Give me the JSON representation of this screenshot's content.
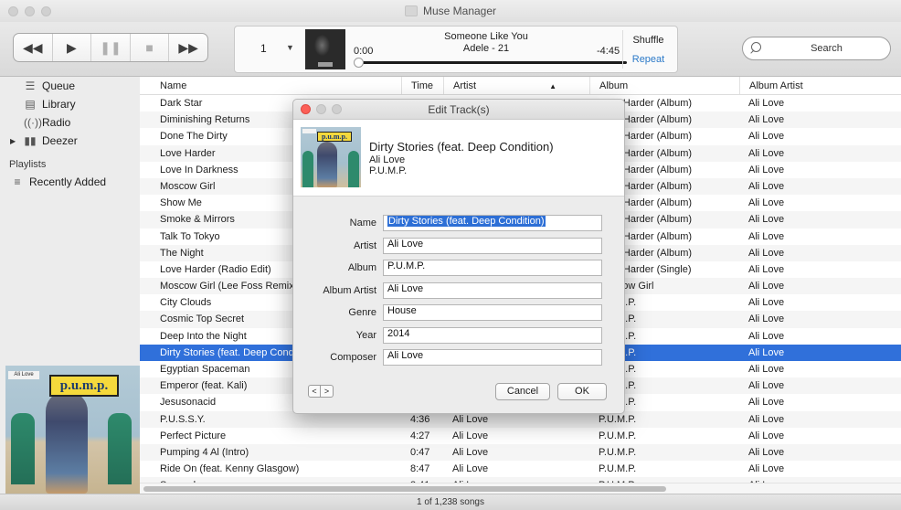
{
  "window": {
    "title": "Muse Manager"
  },
  "controls": {
    "rewind_icon": "rewind-icon",
    "play_icon": "play-icon",
    "pause_icon": "pause-icon",
    "stop_icon": "stop-icon",
    "forward_icon": "fast-forward-icon"
  },
  "player": {
    "queue_number": "1",
    "song_title": "Someone Like You",
    "song_subtitle": "Adele - 21",
    "elapsed": "0:00",
    "remaining": "-4:45",
    "progress": 0,
    "shuffle_label": "Shuffle",
    "repeat_label": "Repeat"
  },
  "search": {
    "placeholder": "Search"
  },
  "sidebar": {
    "items": [
      {
        "label": "Queue",
        "icon": "queue-icon"
      },
      {
        "label": "Library",
        "icon": "library-icon"
      },
      {
        "label": "Radio",
        "icon": "radio-icon"
      },
      {
        "label": "Deezer",
        "icon": "deezer-icon"
      }
    ],
    "playlists_header": "Playlists",
    "playlists": [
      {
        "label": "Recently Added",
        "icon": "playlist-icon"
      }
    ],
    "album_art": {
      "label": "Ali Love",
      "title": "p.u.m.p."
    }
  },
  "table": {
    "columns": [
      "Name",
      "Time",
      "Artist",
      "Album",
      "Album Artist"
    ],
    "sort_indicator": "▲",
    "rows": [
      {
        "name": "Dark Star",
        "time": "",
        "artist": "",
        "album": "Love Harder (Album)",
        "album_artist": "Ali Love"
      },
      {
        "name": "Diminishing Returns",
        "time": "",
        "artist": "",
        "album": "Love Harder (Album)",
        "album_artist": "Ali Love"
      },
      {
        "name": "Done The Dirty",
        "time": "",
        "artist": "",
        "album": "Love Harder (Album)",
        "album_artist": "Ali Love"
      },
      {
        "name": "Love Harder",
        "time": "",
        "artist": "",
        "album": "Love Harder (Album)",
        "album_artist": "Ali Love"
      },
      {
        "name": "Love In Darkness",
        "time": "",
        "artist": "",
        "album": "Love Harder (Album)",
        "album_artist": "Ali Love"
      },
      {
        "name": "Moscow Girl",
        "time": "",
        "artist": "",
        "album": "Love Harder (Album)",
        "album_artist": "Ali Love"
      },
      {
        "name": "Show Me",
        "time": "",
        "artist": "",
        "album": "Love Harder (Album)",
        "album_artist": "Ali Love"
      },
      {
        "name": "Smoke & Mirrors",
        "time": "",
        "artist": "",
        "album": "Love Harder (Album)",
        "album_artist": "Ali Love"
      },
      {
        "name": "Talk To Tokyo",
        "time": "",
        "artist": "",
        "album": "Love Harder (Album)",
        "album_artist": "Ali Love"
      },
      {
        "name": "The Night",
        "time": "",
        "artist": "",
        "album": "Love Harder (Album)",
        "album_artist": "Ali Love"
      },
      {
        "name": "Love Harder (Radio Edit)",
        "time": "",
        "artist": "",
        "album": "Love Harder (Single)",
        "album_artist": "Ali Love"
      },
      {
        "name": "Moscow Girl (Lee Foss Remix)",
        "time": "",
        "artist": "",
        "album": "Moscow Girl",
        "album_artist": "Ali Love"
      },
      {
        "name": "City Clouds",
        "time": "",
        "artist": "",
        "album": "P.U.M.P.",
        "album_artist": "Ali Love"
      },
      {
        "name": "Cosmic Top Secret",
        "time": "",
        "artist": "",
        "album": "P.U.M.P.",
        "album_artist": "Ali Love"
      },
      {
        "name": "Deep Into the Night",
        "time": "",
        "artist": "",
        "album": "P.U.M.P.",
        "album_artist": "Ali Love"
      },
      {
        "name": "Dirty Stories (feat. Deep Condition)",
        "time": "",
        "artist": "",
        "album": "P.U.M.P.",
        "album_artist": "Ali Love",
        "selected": true
      },
      {
        "name": "Egyptian Spaceman",
        "time": "",
        "artist": "",
        "album": "P.U.M.P.",
        "album_artist": "Ali Love"
      },
      {
        "name": "Emperor (feat. Kali)",
        "time": "",
        "artist": "",
        "album": "P.U.M.P.",
        "album_artist": "Ali Love"
      },
      {
        "name": "Jesusonacid",
        "time": "",
        "artist": "",
        "album": "P.U.M.P.",
        "album_artist": "Ali Love"
      },
      {
        "name": "P.U.S.S.Y.",
        "time": "4:36",
        "artist": "Ali Love",
        "album": "P.U.M.P.",
        "album_artist": "Ali Love"
      },
      {
        "name": "Perfect Picture",
        "time": "4:27",
        "artist": "Ali Love",
        "album": "P.U.M.P.",
        "album_artist": "Ali Love"
      },
      {
        "name": "Pumping 4 Al (Intro)",
        "time": "0:47",
        "artist": "Ali Love",
        "album": "P.U.M.P.",
        "album_artist": "Ali Love"
      },
      {
        "name": "Ride On (feat. Kenny Glasgow)",
        "time": "8:47",
        "artist": "Ali Love",
        "album": "P.U.M.P.",
        "album_artist": "Ali Love"
      },
      {
        "name": "Surrender",
        "time": "3:41",
        "artist": "Ali Love",
        "album": "P.U.M.P.",
        "album_artist": "Ali Love"
      }
    ]
  },
  "status": {
    "text": "1 of 1,238 songs"
  },
  "dialog": {
    "title": "Edit Track(s)",
    "track_title": "Dirty Stories (feat. Deep Condition)",
    "track_artist": "Ali Love",
    "track_album": "P.U.M.P.",
    "art_title": "p.u.m.p.",
    "fields": [
      {
        "label": "Name",
        "value": "Dirty Stories (feat. Deep Condition)"
      },
      {
        "label": "Artist",
        "value": "Ali Love"
      },
      {
        "label": "Album",
        "value": "P.U.M.P."
      },
      {
        "label": "Album Artist",
        "value": "Ali Love"
      },
      {
        "label": "Genre",
        "value": "House"
      },
      {
        "label": "Year",
        "value": "2014"
      },
      {
        "label": "Composer",
        "value": "Ali Love"
      }
    ],
    "prev_label": "<",
    "next_label": ">",
    "cancel_label": "Cancel",
    "ok_label": "OK"
  }
}
